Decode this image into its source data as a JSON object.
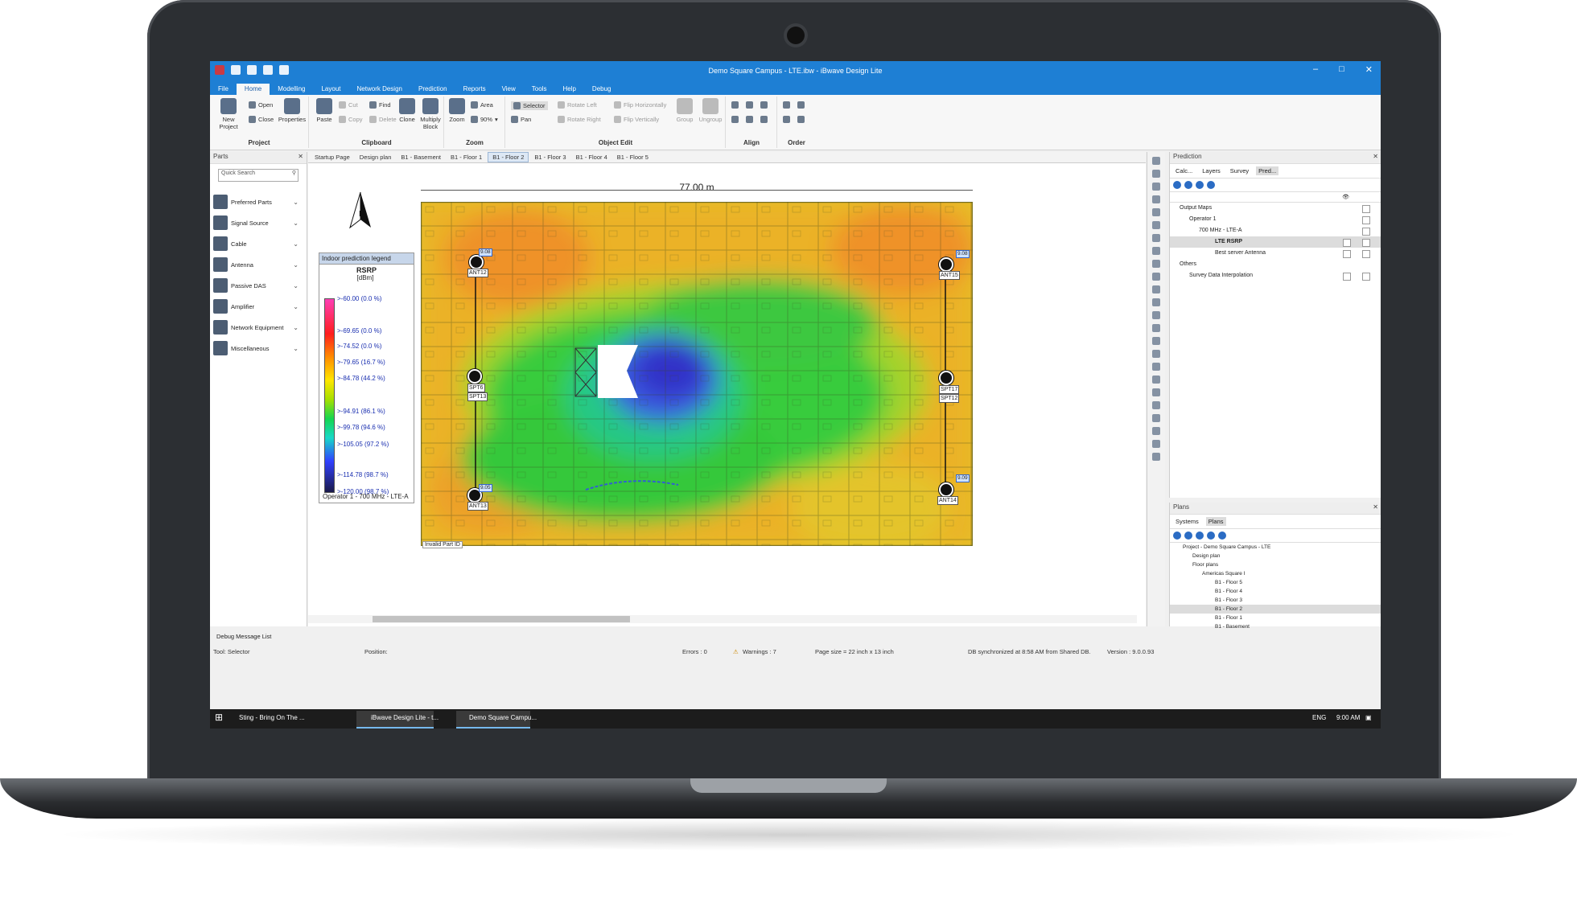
{
  "window": {
    "title": "Demo Square Campus - LTE.ibw - iBwave Design Lite"
  },
  "menu_tabs": [
    "File",
    "Home",
    "Modelling",
    "Layout",
    "Network Design",
    "Prediction",
    "Reports",
    "View",
    "Tools",
    "Help",
    "Debug"
  ],
  "ribbon": {
    "project": {
      "label": "Project",
      "new_project": "New Project",
      "open": "Open",
      "close": "Close",
      "properties": "Properties"
    },
    "clipboard": {
      "label": "Clipboard",
      "paste": "Paste",
      "cut": "Cut",
      "copy": "Copy",
      "find": "Find",
      "delete": "Delete",
      "clone": "Clone",
      "multiply_block": "Multiply Block"
    },
    "zoom": {
      "label": "Zoom",
      "zoom": "Zoom",
      "area": "Area",
      "level": "90%"
    },
    "object_edit": {
      "label": "Object Edit",
      "selector": "Selector",
      "pan": "Pan",
      "rotate_left": "Rotate Left",
      "rotate_right": "Rotate Right",
      "flip_h": "Flip Horizontally",
      "flip_v": "Flip Vertically",
      "group": "Group",
      "ungroup": "Ungroup"
    },
    "align": {
      "label": "Align"
    },
    "order": {
      "label": "Order"
    }
  },
  "parts": {
    "title": "Parts",
    "search_placeholder": "Quick Search",
    "items": [
      {
        "label": "Preferred Parts",
        "icon": "star-icon"
      },
      {
        "label": "Signal Source",
        "icon": "signal-source-icon"
      },
      {
        "label": "Cable",
        "icon": "cable-icon"
      },
      {
        "label": "Antenna",
        "icon": "antenna-icon"
      },
      {
        "label": "Passive DAS",
        "icon": "passive-das-icon"
      },
      {
        "label": "Amplifier",
        "icon": "amplifier-icon"
      },
      {
        "label": "Network Equipment",
        "icon": "network-equipment-icon"
      },
      {
        "label": "Miscellaneous",
        "icon": "miscellaneous-icon"
      }
    ]
  },
  "doc_tabs": [
    "Startup Page",
    "Design plan",
    "B1 - Basement",
    "B1 - Floor 1",
    "B1 - Floor 2",
    "B1 - Floor 3",
    "B1 - Floor 4",
    "B1 - Floor 5"
  ],
  "active_doc_tab": "B1 - Floor 2",
  "canvas": {
    "scale_label": "77.00 m",
    "invalid_part": "Invalid Part ID",
    "legend": {
      "title": "Indoor prediction legend",
      "metric": "RSRP",
      "unit": "[dBm]",
      "entries": [
        ">-60.00 (0.0 %)",
        ">-69.65 (0.0 %)",
        ">-74.52 (0.0 %)",
        ">-79.65 (16.7 %)",
        ">-84.78 (44.2 %)",
        ">-94.91 (86.1 %)",
        ">-99.78 (94.6 %)",
        ">-105.05 (97.2 %)",
        ">-114.78 (98.7 %)",
        ">-120.00 (98.7 %)"
      ],
      "footer": "Operator 1 - 700 MHz - LTE-A"
    },
    "antennas": [
      {
        "label": "ANT12",
        "value": "9.08"
      },
      {
        "label": "ANT15",
        "value": "9.08"
      },
      {
        "label": "SPT6",
        "sub": "SPT13"
      },
      {
        "label": "SPT17",
        "sub": "SPT12"
      },
      {
        "label": "ANT13",
        "value": "9.05"
      },
      {
        "label": "ANT14",
        "value": "9.09"
      }
    ]
  },
  "prediction_panel": {
    "title": "Prediction",
    "tabs": [
      "Calc...",
      "Layers",
      "Survey",
      "Pred..."
    ],
    "tree": [
      {
        "label": "Output Maps",
        "level": 0
      },
      {
        "label": "Operator 1",
        "level": 1
      },
      {
        "label": "700 MHz - LTE-A",
        "level": 2
      },
      {
        "label": "LTE RSRP",
        "level": 3,
        "selected": true
      },
      {
        "label": "Best server Antenna",
        "level": 3
      },
      {
        "label": "Others",
        "level": 0
      },
      {
        "label": "Survey Data Interpolation",
        "level": 1
      }
    ]
  },
  "plans_panel": {
    "title": "Plans",
    "tabs": [
      "Systems",
      "Plans"
    ],
    "tree": [
      {
        "label": "Project - Demo Square Campus - LTE",
        "level": 0
      },
      {
        "label": "Design plan",
        "level": 1
      },
      {
        "label": "Floor plans",
        "level": 1
      },
      {
        "label": "Americas Square I",
        "level": 2
      },
      {
        "label": "B1 - Floor 5",
        "level": 3
      },
      {
        "label": "B1 - Floor 4",
        "level": 3
      },
      {
        "label": "B1 - Floor 3",
        "level": 3
      },
      {
        "label": "B1 - Floor 2",
        "level": 3,
        "selected": true
      },
      {
        "label": "B1 - Floor 1",
        "level": 3
      },
      {
        "label": "B1 - Basement",
        "level": 3
      }
    ]
  },
  "debug_label": "Debug Message List",
  "status": {
    "tool": "Tool: Selector",
    "position": "Position:",
    "errors": "Errors : 0",
    "warnings": "Warnings : 7",
    "page_size": "Page size = 22 inch x 13 inch",
    "db": "DB synchronized at 8:58 AM from Shared DB.",
    "version": "Version : 9.0.0.93"
  },
  "taskbar": {
    "items": [
      "Sting - Bring On The ...",
      "iBwave Design Lite - t...",
      "Demo Square Campu..."
    ],
    "lang": "ENG",
    "time": "9:00 AM"
  },
  "colors": {
    "titlebar": "#1e7fd4",
    "accent": "#2b6cc4"
  }
}
